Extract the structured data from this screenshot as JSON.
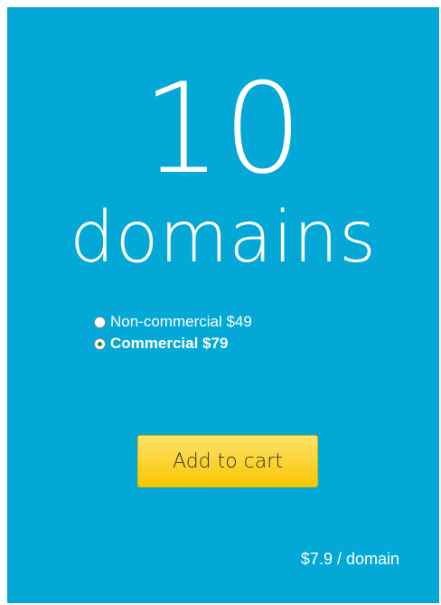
{
  "plan": {
    "count": "10",
    "unit": "domains"
  },
  "options": [
    {
      "label": "Non-commercial $49",
      "checked": false
    },
    {
      "label": "Commercial $79",
      "checked": true
    }
  ],
  "button": {
    "label": "Add to cart"
  },
  "price_note": "$7.9 / domain",
  "colors": {
    "background": "#04a8d6",
    "button": "#f8c600"
  }
}
